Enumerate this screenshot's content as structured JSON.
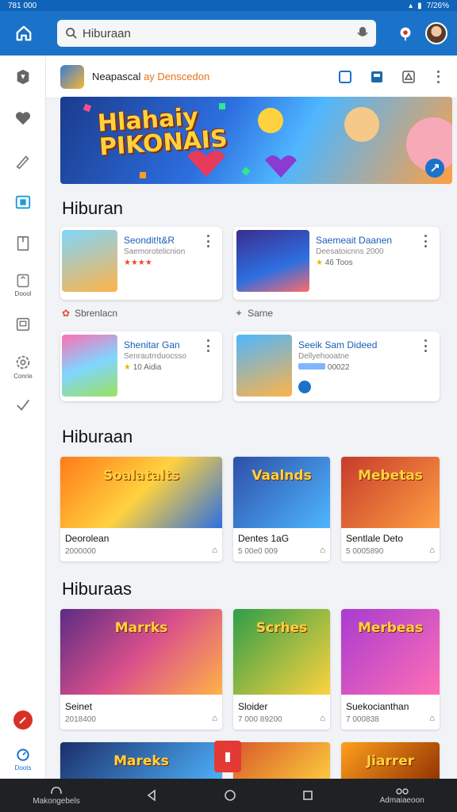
{
  "status": {
    "left": "781 000",
    "time": "7/26%"
  },
  "search": {
    "value": "Hiburaan",
    "placeholder": "Hiburaan"
  },
  "rail": {
    "items": [
      {
        "icon": "puzzle-icon",
        "label": ""
      },
      {
        "icon": "heart-icon",
        "label": ""
      },
      {
        "icon": "brush-icon",
        "label": ""
      },
      {
        "icon": "camera-icon",
        "label": ""
      },
      {
        "icon": "bookmark-icon",
        "label": ""
      },
      {
        "icon": "docs-icon",
        "label": "Doool"
      },
      {
        "icon": "gallery-icon",
        "label": ""
      },
      {
        "icon": "settings-icon",
        "label": "Conrie"
      },
      {
        "icon": "check-icon",
        "label": ""
      }
    ],
    "bottom_label": "Doots"
  },
  "toolbar": {
    "app_name": "Neapascal",
    "app_name_accent": "ay Denscedon"
  },
  "banner": {
    "title_line1": "Hlahaiy",
    "title_line2": "PIKONAIS",
    "accent": "#1a73c8"
  },
  "sections": [
    {
      "title": "Hiburan"
    },
    {
      "title": "Hiburaan"
    },
    {
      "title": "Hiburaas"
    }
  ],
  "featured_cards": [
    {
      "title": "Seondit!t&R",
      "sub": "Saemorotelicnion",
      "rating": "★★★★",
      "rating_text": ""
    },
    {
      "title": "Saemeait Daanen",
      "sub": "Deesatoicnns  2000",
      "rating": "★",
      "rating_text": "46 Toos"
    },
    {
      "title": "Shenitar Gan",
      "sub": "Senrautrrduocsso",
      "rating": "★",
      "rating_text": "10 Aidia"
    },
    {
      "title": "Seeik Sam Dideed",
      "sub": "Dellyehooatne",
      "rating": "",
      "rating_text": "00022"
    }
  ],
  "labels": [
    {
      "text": "Sbrenlacn"
    },
    {
      "text": "Sarne"
    }
  ],
  "tiles_row1": [
    {
      "name": "Deorolean",
      "meta": "2000000",
      "img_text": "Soalatalts",
      "bg": "#ff7a18"
    },
    {
      "name": "Dentes 1aG",
      "meta": "5 00e0 009",
      "img_text": "Vaalnds",
      "bg": "#2d4fa8"
    },
    {
      "name": "Sentlale Deto",
      "meta": "5 0005890",
      "img_text": "Mebetas",
      "bg": "#c63b2b"
    }
  ],
  "tiles_row2": [
    {
      "name": "Seinet",
      "meta": "2018400",
      "img_text": "Marrks",
      "bg": "#5b2c83"
    },
    {
      "name": "Sloider",
      "meta": "7 000 89200",
      "img_text": "Scrhes",
      "bg": "#2e9e48"
    },
    {
      "name": "Suekocianthan",
      "meta": "7 000838",
      "img_text": "Merbeas",
      "bg": "#a83bd1"
    }
  ],
  "tiles_row3": [
    {
      "name": "",
      "meta": "",
      "img_text": "Mareks",
      "bg": "#1c2f6b"
    },
    {
      "name": "",
      "meta": "",
      "img_text": "",
      "bg": "#d85a2a"
    },
    {
      "name": "",
      "meta": "",
      "img_text": "Jiarrer",
      "bg": "#ff9f1c"
    }
  ],
  "nav": {
    "left_label": "Makongebels",
    "right_label": "Admaiaeoon"
  }
}
